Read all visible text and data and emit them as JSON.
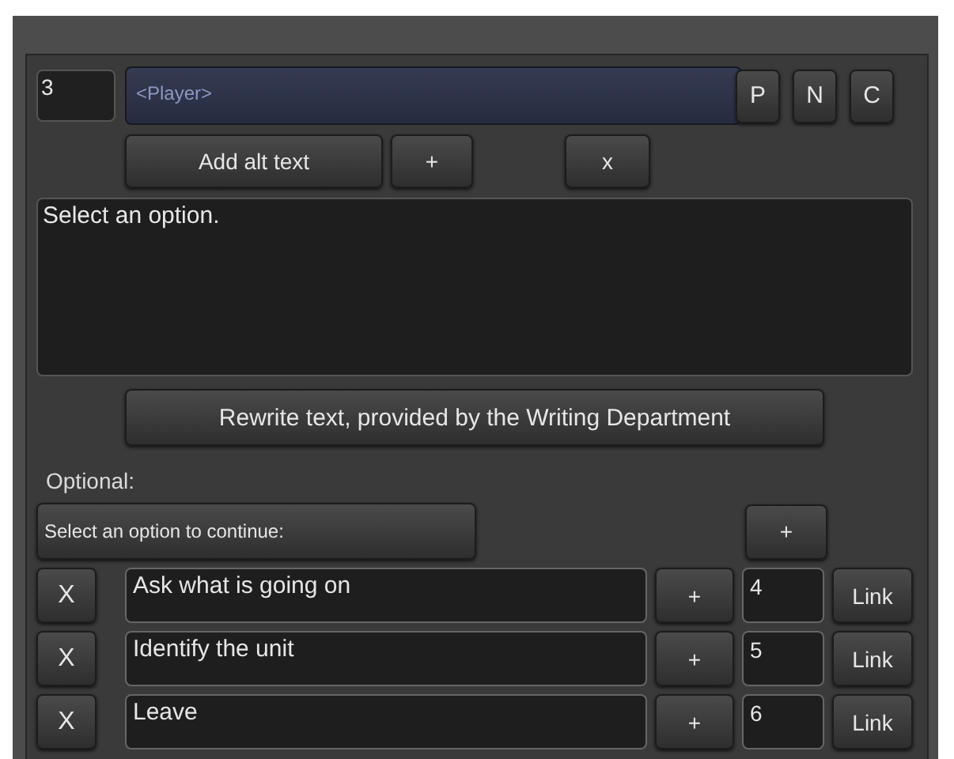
{
  "id_field": {
    "value": "3"
  },
  "speaker_field": {
    "value": "<Player>"
  },
  "speaker_buttons": [
    "P",
    "N",
    "C"
  ],
  "alt_text": {
    "add_button": "Add alt text",
    "plus_button": "+",
    "remove_button": "x"
  },
  "text_area": {
    "value": "Select an option."
  },
  "rewrite_button": "Rewrite text, provided by the Writing Department",
  "optional_label": "Optional:",
  "option_prompt_button": "Select an option to continue:",
  "add_option_button": "+",
  "options": [
    {
      "remove": "X",
      "text": "Ask what is going on",
      "plus": "+",
      "target": "4",
      "link": "Link"
    },
    {
      "remove": "X",
      "text": "Identify the unit",
      "plus": "+",
      "target": "5",
      "link": "Link"
    },
    {
      "remove": "X",
      "text": "Leave",
      "plus": "+",
      "target": "6",
      "link": "Link"
    }
  ]
}
